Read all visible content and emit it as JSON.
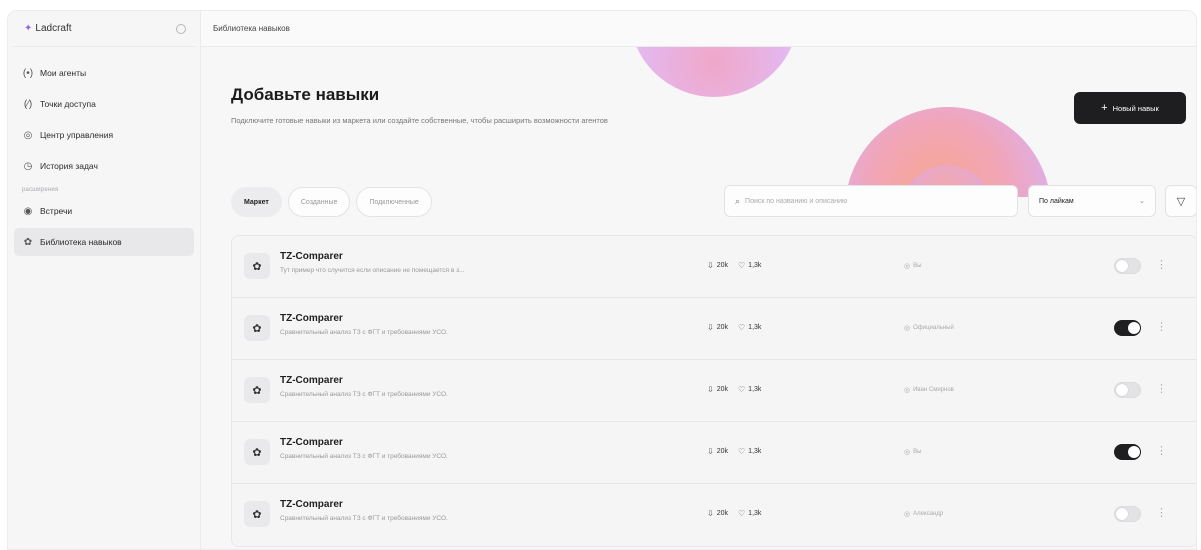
{
  "brand": {
    "name": "Ladcraft"
  },
  "topbar": {
    "breadcrumb": "Библиотека навыков"
  },
  "sidebar": {
    "items": [
      {
        "label": "Мои агенты",
        "icon": "agent-icon"
      },
      {
        "label": "Точки доступа",
        "icon": "access-point-icon"
      },
      {
        "label": "Центр управления",
        "icon": "control-center-icon"
      },
      {
        "label": "История задач",
        "icon": "history-icon"
      }
    ],
    "section_label": "расширения",
    "ext_items": [
      {
        "label": "Встречи",
        "icon": "meetings-icon"
      },
      {
        "label": "Библиотека навыков",
        "icon": "skills-library-icon",
        "active": true
      }
    ]
  },
  "hero": {
    "title": "Добавьте навыки",
    "subtitle": "Подключите готовые навыки из маркета или создайте собственные, чтобы расширить возможности агентов",
    "new_button": "Новый навык"
  },
  "tabs": [
    {
      "label": "Маркет",
      "active": true
    },
    {
      "label": "Созданные",
      "active": false
    },
    {
      "label": "Подключенные",
      "active": false
    }
  ],
  "search": {
    "placeholder": "Поиск по названию и описанию"
  },
  "sort": {
    "value": "По лайкам"
  },
  "skills": [
    {
      "title": "TZ-Comparer",
      "description": "Тут пример что случится если описание не помещается в з...",
      "downloads": "20k",
      "likes": "1,3k",
      "author": "Вы",
      "enabled": false
    },
    {
      "title": "TZ-Comparer",
      "description": "Сравнительный анализ ТЗ с ФГТ и требованиями УСО.",
      "downloads": "20k",
      "likes": "1,3k",
      "author": "Официальный",
      "enabled": true
    },
    {
      "title": "TZ-Comparer",
      "description": "Сравнительный анализ ТЗ с ФГТ и требованиями УСО.",
      "downloads": "20k",
      "likes": "1,3k",
      "author": "Иван Смирнов",
      "enabled": false
    },
    {
      "title": "TZ-Comparer",
      "description": "Сравнительный анализ ТЗ с ФГТ и требованиями УСО.",
      "downloads": "20k",
      "likes": "1,3k",
      "author": "Вы",
      "enabled": true
    },
    {
      "title": "TZ-Comparer",
      "description": "Сравнительный анализ ТЗ с ФГТ и требованиями УСО.",
      "downloads": "20k",
      "likes": "1,3k",
      "author": "Александр",
      "enabled": false
    }
  ],
  "colors": {
    "accent": "#1e1e20",
    "brand": "#8a6be8"
  }
}
